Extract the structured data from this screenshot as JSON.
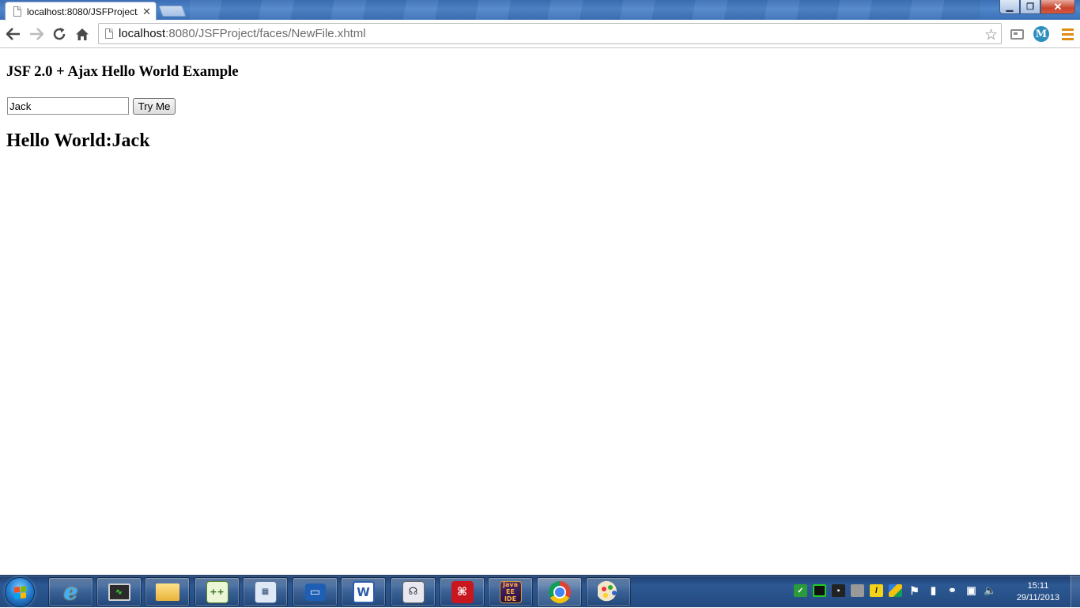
{
  "browser": {
    "tab": {
      "title": "localhost:8080/JSFProject/"
    },
    "address": {
      "host": "localhost",
      "rest": ":8080/JSFProject/faces/NewFile.xhtml"
    }
  },
  "page": {
    "title": "JSF 2.0 + Ajax Hello World Example",
    "name_input_value": "Jack",
    "button_label": "Try Me",
    "output_text": "Hello World:Jack"
  },
  "taskbar": {
    "apps": [
      {
        "name": "internet-explorer-icon",
        "active": false
      },
      {
        "name": "system-monitor-icon",
        "active": false
      },
      {
        "name": "windows-explorer-icon",
        "active": false
      },
      {
        "name": "notepad-plus-plus-icon",
        "active": false
      },
      {
        "name": "calculator-icon",
        "active": false
      },
      {
        "name": "remote-desktop-icon",
        "active": false
      },
      {
        "name": "microsoft-word-icon",
        "active": false
      },
      {
        "name": "eclipse-icon",
        "active": false
      },
      {
        "name": "adobe-reader-icon",
        "active": false
      },
      {
        "name": "java-ee-ide-icon",
        "active": false
      },
      {
        "name": "google-chrome-icon",
        "active": true
      },
      {
        "name": "paint-icon",
        "active": false
      }
    ],
    "java_ee_label": "Java EE IDE",
    "clock": {
      "time": "15:11",
      "date": "29/11/2013"
    }
  }
}
